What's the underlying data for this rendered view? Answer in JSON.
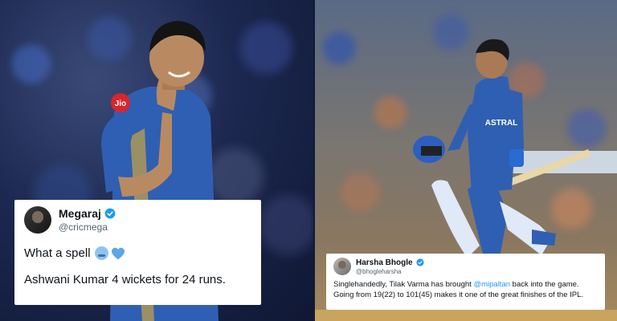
{
  "colors": {
    "verified_blue": "#1d9bf0",
    "mi_blue": "#2f5fb3",
    "tweet_bg": "#ffffff",
    "handle_gray": "#536471"
  },
  "tweet_left": {
    "name": "Megaraj",
    "handle": "@cricmega",
    "text_line1": "What a spell",
    "emojis": [
      "crying-face-icon",
      "blue-heart-icon"
    ],
    "text_line2": "Ashwani Kumar 4 wickets for 24 runs."
  },
  "tweet_right": {
    "name": "Harsha Bhogle",
    "handle": "@bhogleharsha",
    "text_before_mention": "Singlehandedly, Tilak Varma has brought ",
    "mention": "@mipaltan",
    "text_after_mention": " back into the game.",
    "text_line2": "Going from 19(22) to 101(45) makes it one of the great finishes of the IPL."
  },
  "photo_left": {
    "jersey_sponsor": "Jio"
  },
  "photo_right": {
    "jersey_sponsor": "ASTRAL"
  }
}
